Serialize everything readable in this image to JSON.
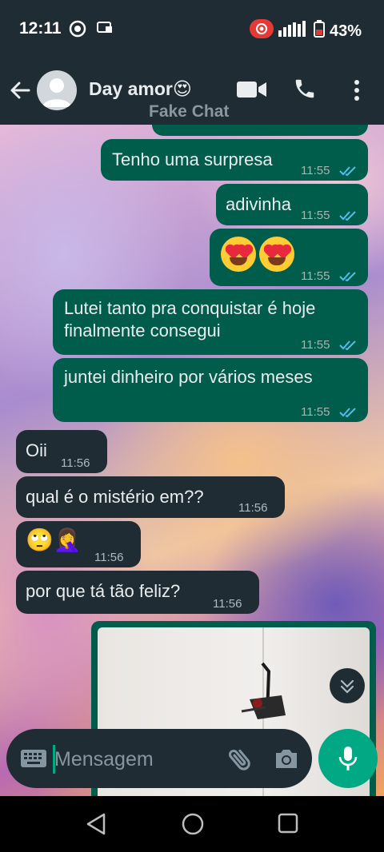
{
  "status_bar": {
    "time": "12:11",
    "battery": "43%",
    "icons": [
      "record-icon",
      "screen-cast-icon",
      "recording-icon",
      "signal-icon",
      "battery-icon"
    ]
  },
  "header": {
    "contact_name": "Day amor😍",
    "watermark": "Fake Chat",
    "icons": [
      "back-arrow-icon",
      "avatar-icon",
      "video-call-icon",
      "voice-call-icon",
      "more-options-icon"
    ]
  },
  "messages": [
    {
      "id": "m1",
      "dir": "out",
      "text": "Tenho uma surpresa",
      "time": "11:55",
      "read": true
    },
    {
      "id": "m2",
      "dir": "out",
      "text": "adivinha",
      "time": "11:55",
      "read": true
    },
    {
      "id": "m3",
      "dir": "out",
      "text": "😍😍",
      "time": "11:55",
      "read": true
    },
    {
      "id": "m4",
      "dir": "out",
      "text_lines": [
        "Lutei tanto pra conquistar é hoje",
        "finalmente consegui"
      ],
      "time": "11:55",
      "read": true
    },
    {
      "id": "m5",
      "dir": "out",
      "text": "juntei dinheiro por vários meses",
      "time": "11:55",
      "read": true
    },
    {
      "id": "m6",
      "dir": "in",
      "text": "Oii",
      "time": "11:56"
    },
    {
      "id": "m7",
      "dir": "in",
      "text": "qual é o mistério em??",
      "time": "11:56"
    },
    {
      "id": "m8",
      "dir": "in",
      "text": "🙄🤦‍♀️",
      "time": "11:56"
    },
    {
      "id": "m9",
      "dir": "in",
      "text": "por que tá tão feliz?",
      "time": "11:56"
    }
  ],
  "composer": {
    "placeholder": "Mensagem",
    "icons": [
      "keyboard-icon",
      "attach-icon",
      "camera-icon",
      "mic-icon"
    ]
  },
  "colors": {
    "outgoing_bubble": "#005c4b",
    "incoming_bubble": "#202c33",
    "accent": "#00a884",
    "read_ticks": "#53bdeb"
  }
}
